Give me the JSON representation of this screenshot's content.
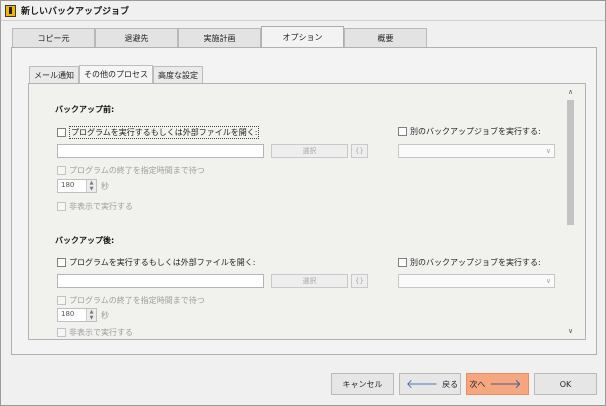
{
  "window": {
    "title": "新しいバックアップジョブ"
  },
  "tabs": [
    {
      "label": "コピー元"
    },
    {
      "label": "退避先"
    },
    {
      "label": "実施計画"
    },
    {
      "label": "オプション"
    },
    {
      "label": "概要"
    }
  ],
  "subtabs": [
    {
      "label": "メール通知"
    },
    {
      "label": "その他のプロセス"
    },
    {
      "label": "高度な設定"
    }
  ],
  "before": {
    "title": "バックアップ前:",
    "run_program_label": "プログラムを実行するもしくは外部ファイルを開く:",
    "program_path": "",
    "browse_label": "選択",
    "small_label": "{}",
    "run_other_job_label": "別のバックアップジョブを実行する:",
    "job_select": "",
    "wait_label": "プログラムの終了を指定時間まで待つ",
    "wait_value": "180",
    "wait_unit": "秒",
    "hidden_label": "非表示で実行する"
  },
  "after": {
    "title": "バックアップ後:",
    "run_program_label": "プログラムを実行するもしくは外部ファイルを開く:",
    "program_path": "",
    "browse_label": "選択",
    "small_label": "{}",
    "run_other_job_label": "別のバックアップジョブを実行する:",
    "job_select": "",
    "wait_label": "プログラムの終了を指定時間まで待つ",
    "wait_value": "180",
    "wait_unit": "秒",
    "hidden_label": "非表示で実行する"
  },
  "buttons": {
    "cancel": "キャンセル",
    "back": "戻る",
    "next": "次へ",
    "ok": "OK"
  },
  "colors": {
    "next_button": "#f6a77f",
    "arrow": "#4a78b8",
    "app_icon": "#f2b705"
  }
}
